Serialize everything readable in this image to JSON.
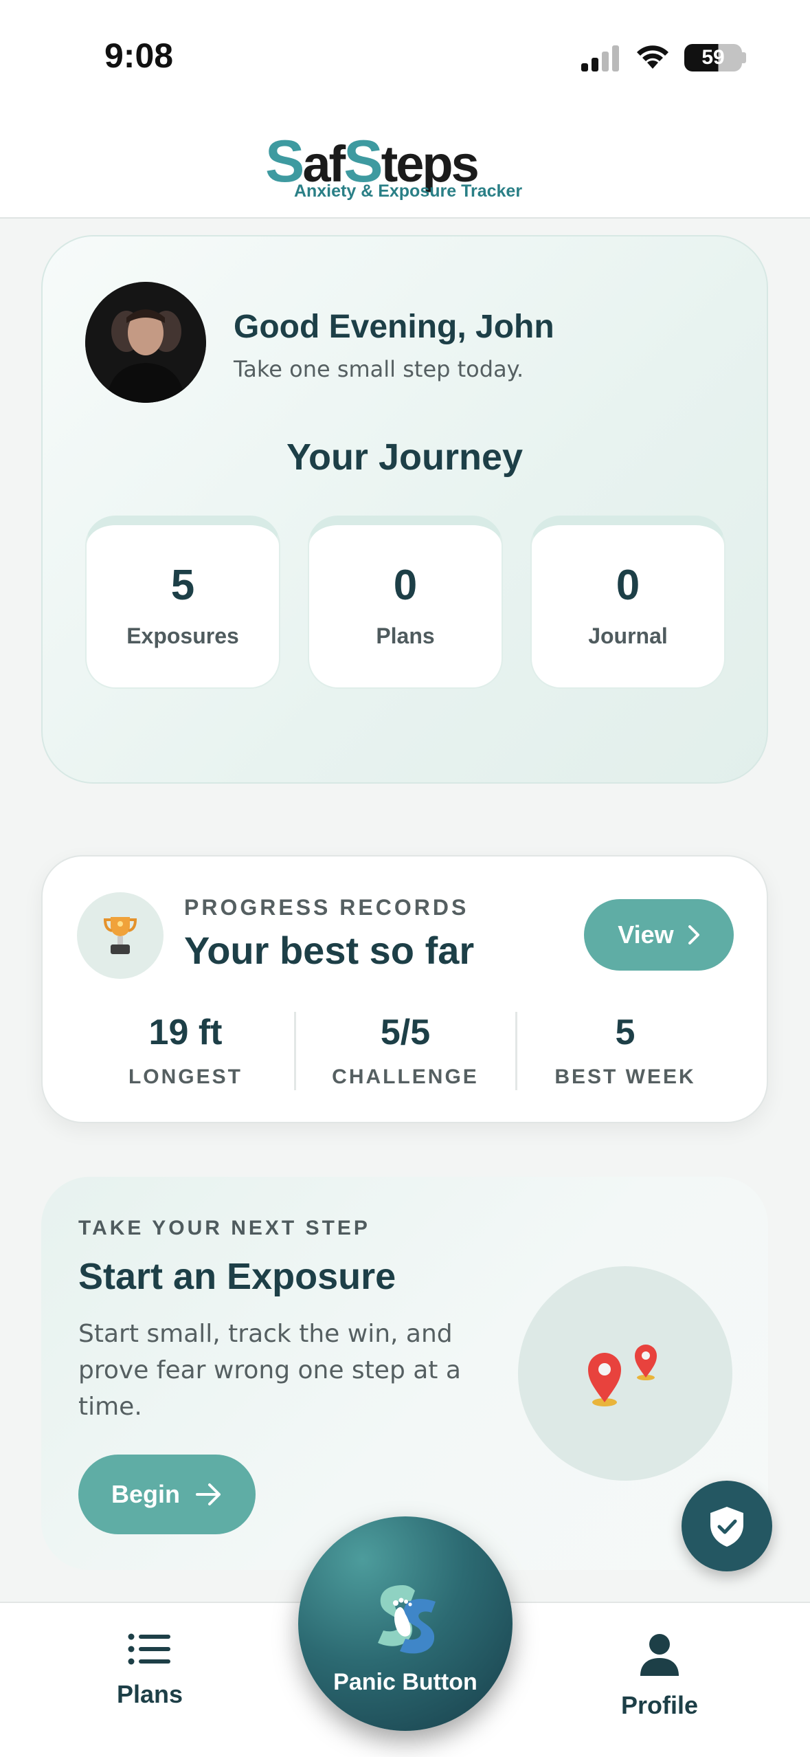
{
  "status_bar": {
    "time": "9:08",
    "battery": "59"
  },
  "header": {
    "logo_text": [
      "S",
      "af",
      "S",
      "teps"
    ],
    "tagline": "Anxiety & Exposure Tracker"
  },
  "greeting": {
    "title": "Good Evening, John",
    "subtitle": "Take one small step today.",
    "journey_title": "Your Journey",
    "stats": [
      {
        "value": "5",
        "label": "Exposures"
      },
      {
        "value": "0",
        "label": "Plans"
      },
      {
        "value": "0",
        "label": "Journal"
      }
    ]
  },
  "progress": {
    "eyebrow": "PROGRESS RECORDS",
    "title": "Your best so far",
    "view_label": "View",
    "metrics": [
      {
        "value": "19 ft",
        "label": "LONGEST"
      },
      {
        "value": "5/5",
        "label": "CHALLENGE"
      },
      {
        "value": "5",
        "label": "BEST WEEK"
      }
    ]
  },
  "exposure": {
    "eyebrow": "TAKE YOUR NEXT STEP",
    "title": "Start an Exposure",
    "body": "Start small, track the win, and prove fear wrong one step at a time.",
    "begin_label": "Begin"
  },
  "nav": {
    "plans_label": "Plans",
    "panic_label": "Panic Button",
    "profile_label": "Profile"
  },
  "colors": {
    "accent": "#5fada5",
    "dark_teal": "#1d3f47",
    "fab": "#245762"
  }
}
